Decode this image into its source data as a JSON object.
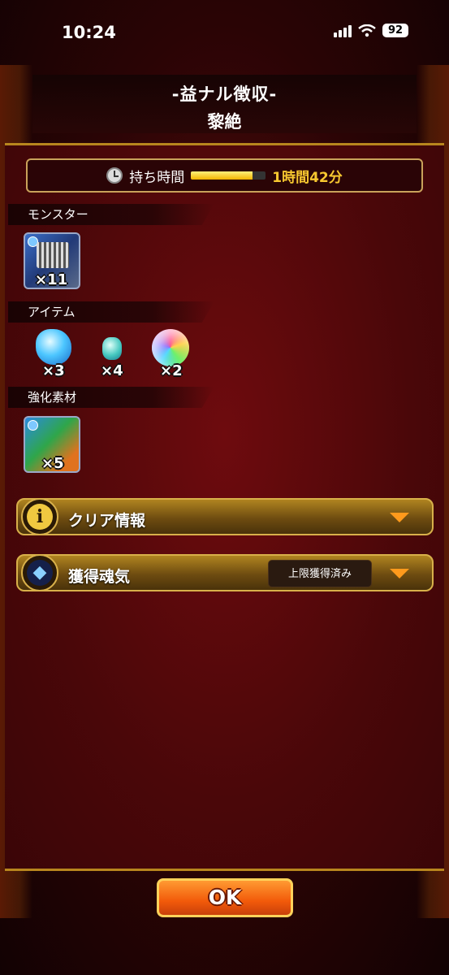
{
  "status_bar": {
    "time": "10:24",
    "battery": "92"
  },
  "title": {
    "main": "-益ナル徴収-",
    "sub": "黎絶"
  },
  "time_limit": {
    "label": "持ち時間",
    "value": "1時間42分",
    "remaining_fraction": 0.82
  },
  "sections": {
    "monster": {
      "label": "モンスター",
      "items": [
        {
          "icon": "monster-icon",
          "count": "×11"
        }
      ]
    },
    "item": {
      "label": "アイテム",
      "items": [
        {
          "icon": "blue-gem-icon",
          "count": "×3"
        },
        {
          "icon": "small-gem-icon",
          "count": "×4"
        },
        {
          "icon": "rainbow-orb-icon",
          "count": "×2"
        }
      ]
    },
    "material": {
      "label": "強化素材",
      "items": [
        {
          "icon": "material-icon",
          "count": "×5"
        }
      ]
    }
  },
  "accordions": {
    "clear_info": {
      "label": "クリア情報",
      "icon": "info-icon"
    },
    "soul": {
      "label": "獲得魂気",
      "icon": "soul-flame-icon",
      "status": "上限獲得済み"
    }
  },
  "ok_button": {
    "label": "OK"
  },
  "colors": {
    "accent_gold": "#d8b04a",
    "time_value": "#f7c830",
    "ok_orange": "#f25a0a"
  }
}
